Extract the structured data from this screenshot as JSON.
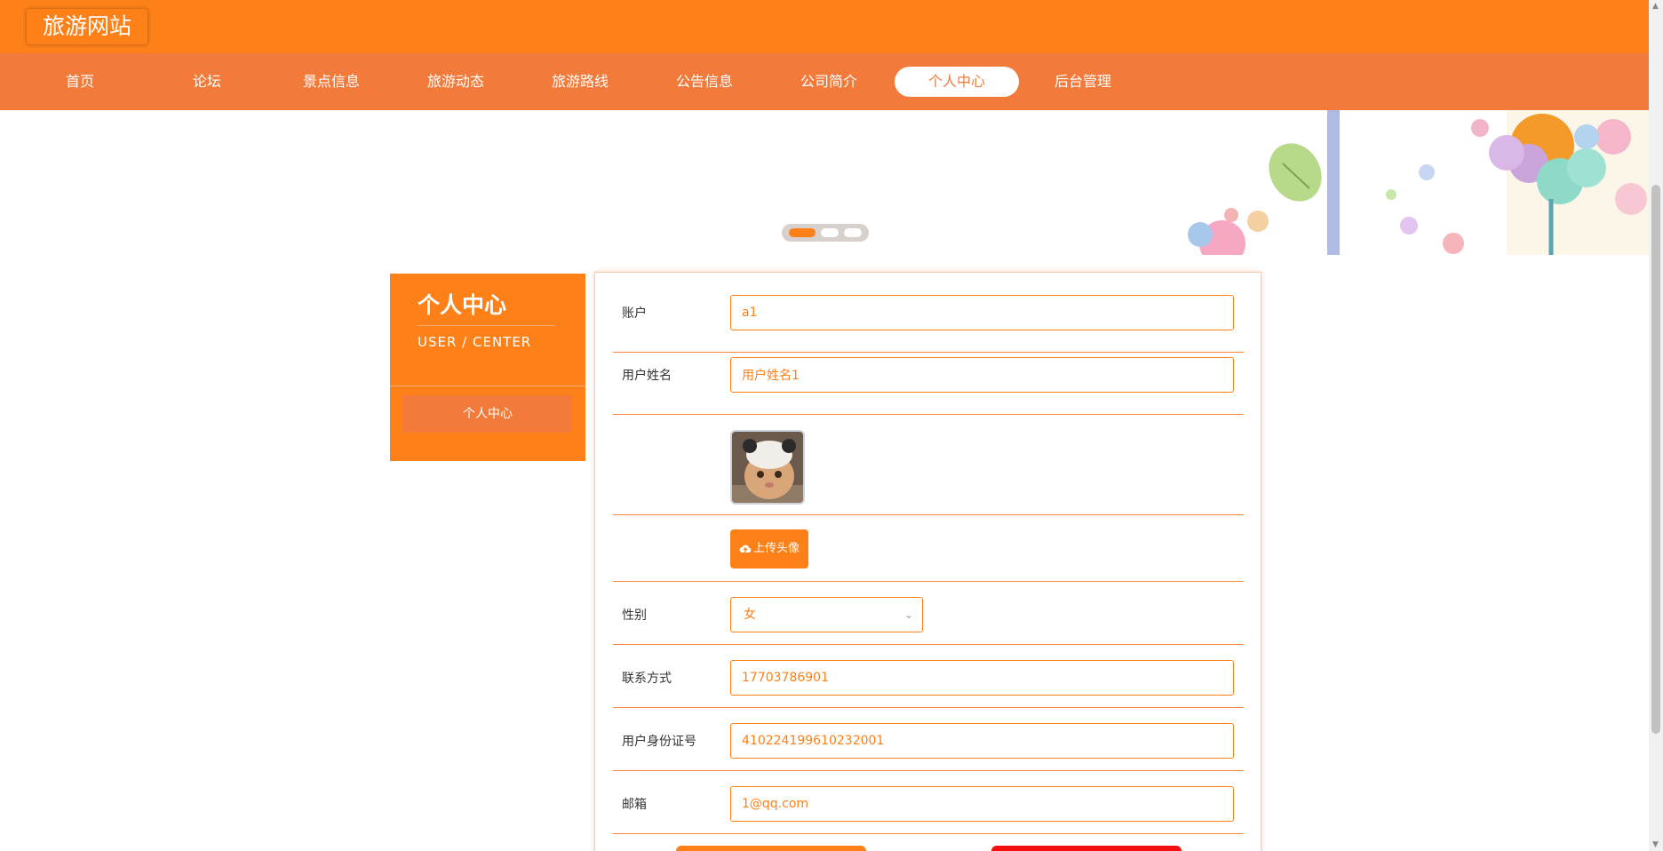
{
  "header": {
    "logo": "旅游网站"
  },
  "nav": {
    "items": [
      {
        "label": "首页"
      },
      {
        "label": "论坛"
      },
      {
        "label": "景点信息"
      },
      {
        "label": "旅游动态"
      },
      {
        "label": "旅游路线"
      },
      {
        "label": "公告信息"
      },
      {
        "label": "公司简介"
      },
      {
        "label": "个人中心",
        "active": true
      },
      {
        "label": "后台管理"
      }
    ]
  },
  "carousel": {
    "slide_count": 3,
    "active_index": 0
  },
  "sidebar": {
    "title": "个人中心",
    "subtitle": "USER / CENTER",
    "menu": [
      {
        "label": "个人中心"
      }
    ]
  },
  "form": {
    "account": {
      "label": "账户",
      "value": "a1"
    },
    "username": {
      "label": "用户姓名",
      "value": "用户姓名1"
    },
    "avatar": {
      "icon": "cat-photo"
    },
    "upload": {
      "label": "上传头像",
      "icon": "cloud-upload-icon"
    },
    "gender": {
      "label": "性别",
      "value": "女"
    },
    "phone": {
      "label": "联系方式",
      "value": "17703786901"
    },
    "id_number": {
      "label": "用户身份证号",
      "value": "410224199610232001"
    },
    "email": {
      "label": "邮箱",
      "value": "1@qq.com"
    }
  },
  "colors": {
    "primary": "#fd8018",
    "nav_bg": "#f27a3a",
    "danger": "#f20f0f"
  }
}
